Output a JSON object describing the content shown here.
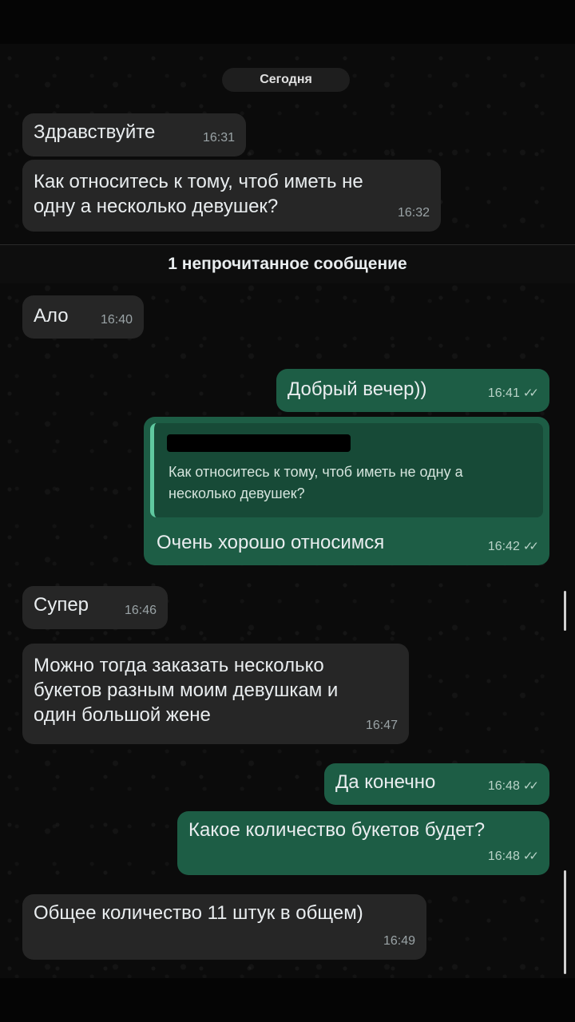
{
  "date_label": "Сегодня",
  "unread_label": "1 непрочитанное сообщение",
  "messages": [
    {
      "dir": "in",
      "text": "Здравствуйте",
      "time": "16:31"
    },
    {
      "dir": "in",
      "text": "Как относитесь к тому, чтоб иметь не\nодну а несколько девушек?",
      "time": "16:32"
    },
    {
      "dir": "in",
      "text": "Ало",
      "time": "16:40"
    },
    {
      "dir": "out",
      "text": "Добрый вечер))",
      "time": "16:41"
    },
    {
      "dir": "out",
      "quote": "Как относитесь к тому, чтоб иметь не одну а\nнесколько девушек?",
      "text": "Очень хорошо относимся",
      "time": "16:42"
    },
    {
      "dir": "in",
      "text": "Супер",
      "time": "16:46"
    },
    {
      "dir": "in",
      "text": "Можно тогда заказать несколько\nбукетов разным моим девушкам и\nодин большой жене",
      "time": "16:47"
    },
    {
      "dir": "out",
      "text": "Да конечно",
      "time": "16:48"
    },
    {
      "dir": "out",
      "text": "Какое количество букетов будет?",
      "time": "16:48"
    },
    {
      "dir": "in",
      "text": "Общее количество 11 штук в общем)",
      "time": "16:49"
    }
  ],
  "colors": {
    "incoming": "#262626",
    "outgoing": "#1d5d45",
    "quote_accent": "#5fc9a0"
  },
  "icons": {
    "read_receipt": "double-check-icon"
  }
}
